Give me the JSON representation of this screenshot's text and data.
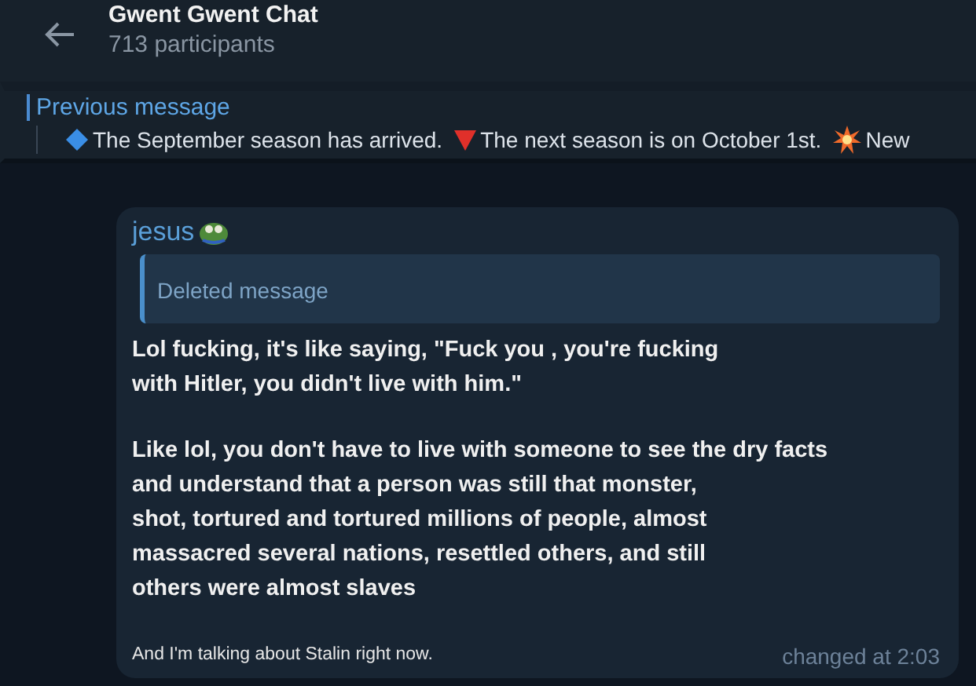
{
  "header": {
    "title": "Gwent Gwent Chat",
    "subtitle": "713 participants"
  },
  "pinned": {
    "label": "Previous message",
    "segments": [
      {
        "kind": "diamond",
        "text": "The September season has arrived."
      },
      {
        "kind": "triangle",
        "text": "The next season is on October 1st."
      },
      {
        "kind": "burst",
        "text": "New"
      }
    ]
  },
  "message": {
    "author": "jesus",
    "reply": {
      "text": "Deleted message"
    },
    "paragraphs": [
      [
        "Lol fucking, it's like saying, \"Fuck you , you're fucking",
        "with Hitler, you didn't live with him.\""
      ],
      [
        "Like lol, you don't have to live with someone to see the dry facts",
        "and understand that a person was still that monster,",
        "shot, tortured and tortured millions of people, almost",
        "massacred several nations, resettled others, and still",
        "others were almost slaves"
      ]
    ],
    "footnote": "And I'm talking about Stalin right now.",
    "time": "changed at 2:03"
  }
}
